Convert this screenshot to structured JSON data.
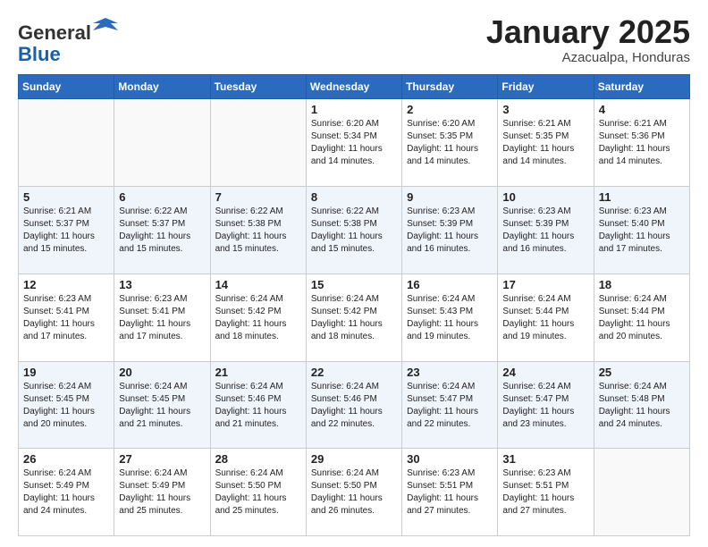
{
  "header": {
    "logo_line1": "General",
    "logo_line2": "Blue",
    "month_title": "January 2025",
    "subtitle": "Azacualpa, Honduras"
  },
  "weekdays": [
    "Sunday",
    "Monday",
    "Tuesday",
    "Wednesday",
    "Thursday",
    "Friday",
    "Saturday"
  ],
  "weeks": [
    [
      {
        "day": "",
        "text": ""
      },
      {
        "day": "",
        "text": ""
      },
      {
        "day": "",
        "text": ""
      },
      {
        "day": "1",
        "text": "Sunrise: 6:20 AM\nSunset: 5:34 PM\nDaylight: 11 hours and 14 minutes."
      },
      {
        "day": "2",
        "text": "Sunrise: 6:20 AM\nSunset: 5:35 PM\nDaylight: 11 hours and 14 minutes."
      },
      {
        "day": "3",
        "text": "Sunrise: 6:21 AM\nSunset: 5:35 PM\nDaylight: 11 hours and 14 minutes."
      },
      {
        "day": "4",
        "text": "Sunrise: 6:21 AM\nSunset: 5:36 PM\nDaylight: 11 hours and 14 minutes."
      }
    ],
    [
      {
        "day": "5",
        "text": "Sunrise: 6:21 AM\nSunset: 5:37 PM\nDaylight: 11 hours and 15 minutes."
      },
      {
        "day": "6",
        "text": "Sunrise: 6:22 AM\nSunset: 5:37 PM\nDaylight: 11 hours and 15 minutes."
      },
      {
        "day": "7",
        "text": "Sunrise: 6:22 AM\nSunset: 5:38 PM\nDaylight: 11 hours and 15 minutes."
      },
      {
        "day": "8",
        "text": "Sunrise: 6:22 AM\nSunset: 5:38 PM\nDaylight: 11 hours and 15 minutes."
      },
      {
        "day": "9",
        "text": "Sunrise: 6:23 AM\nSunset: 5:39 PM\nDaylight: 11 hours and 16 minutes."
      },
      {
        "day": "10",
        "text": "Sunrise: 6:23 AM\nSunset: 5:39 PM\nDaylight: 11 hours and 16 minutes."
      },
      {
        "day": "11",
        "text": "Sunrise: 6:23 AM\nSunset: 5:40 PM\nDaylight: 11 hours and 17 minutes."
      }
    ],
    [
      {
        "day": "12",
        "text": "Sunrise: 6:23 AM\nSunset: 5:41 PM\nDaylight: 11 hours and 17 minutes."
      },
      {
        "day": "13",
        "text": "Sunrise: 6:23 AM\nSunset: 5:41 PM\nDaylight: 11 hours and 17 minutes."
      },
      {
        "day": "14",
        "text": "Sunrise: 6:24 AM\nSunset: 5:42 PM\nDaylight: 11 hours and 18 minutes."
      },
      {
        "day": "15",
        "text": "Sunrise: 6:24 AM\nSunset: 5:42 PM\nDaylight: 11 hours and 18 minutes."
      },
      {
        "day": "16",
        "text": "Sunrise: 6:24 AM\nSunset: 5:43 PM\nDaylight: 11 hours and 19 minutes."
      },
      {
        "day": "17",
        "text": "Sunrise: 6:24 AM\nSunset: 5:44 PM\nDaylight: 11 hours and 19 minutes."
      },
      {
        "day": "18",
        "text": "Sunrise: 6:24 AM\nSunset: 5:44 PM\nDaylight: 11 hours and 20 minutes."
      }
    ],
    [
      {
        "day": "19",
        "text": "Sunrise: 6:24 AM\nSunset: 5:45 PM\nDaylight: 11 hours and 20 minutes."
      },
      {
        "day": "20",
        "text": "Sunrise: 6:24 AM\nSunset: 5:45 PM\nDaylight: 11 hours and 21 minutes."
      },
      {
        "day": "21",
        "text": "Sunrise: 6:24 AM\nSunset: 5:46 PM\nDaylight: 11 hours and 21 minutes."
      },
      {
        "day": "22",
        "text": "Sunrise: 6:24 AM\nSunset: 5:46 PM\nDaylight: 11 hours and 22 minutes."
      },
      {
        "day": "23",
        "text": "Sunrise: 6:24 AM\nSunset: 5:47 PM\nDaylight: 11 hours and 22 minutes."
      },
      {
        "day": "24",
        "text": "Sunrise: 6:24 AM\nSunset: 5:47 PM\nDaylight: 11 hours and 23 minutes."
      },
      {
        "day": "25",
        "text": "Sunrise: 6:24 AM\nSunset: 5:48 PM\nDaylight: 11 hours and 24 minutes."
      }
    ],
    [
      {
        "day": "26",
        "text": "Sunrise: 6:24 AM\nSunset: 5:49 PM\nDaylight: 11 hours and 24 minutes."
      },
      {
        "day": "27",
        "text": "Sunrise: 6:24 AM\nSunset: 5:49 PM\nDaylight: 11 hours and 25 minutes."
      },
      {
        "day": "28",
        "text": "Sunrise: 6:24 AM\nSunset: 5:50 PM\nDaylight: 11 hours and 25 minutes."
      },
      {
        "day": "29",
        "text": "Sunrise: 6:24 AM\nSunset: 5:50 PM\nDaylight: 11 hours and 26 minutes."
      },
      {
        "day": "30",
        "text": "Sunrise: 6:23 AM\nSunset: 5:51 PM\nDaylight: 11 hours and 27 minutes."
      },
      {
        "day": "31",
        "text": "Sunrise: 6:23 AM\nSunset: 5:51 PM\nDaylight: 11 hours and 27 minutes."
      },
      {
        "day": "",
        "text": ""
      }
    ]
  ]
}
